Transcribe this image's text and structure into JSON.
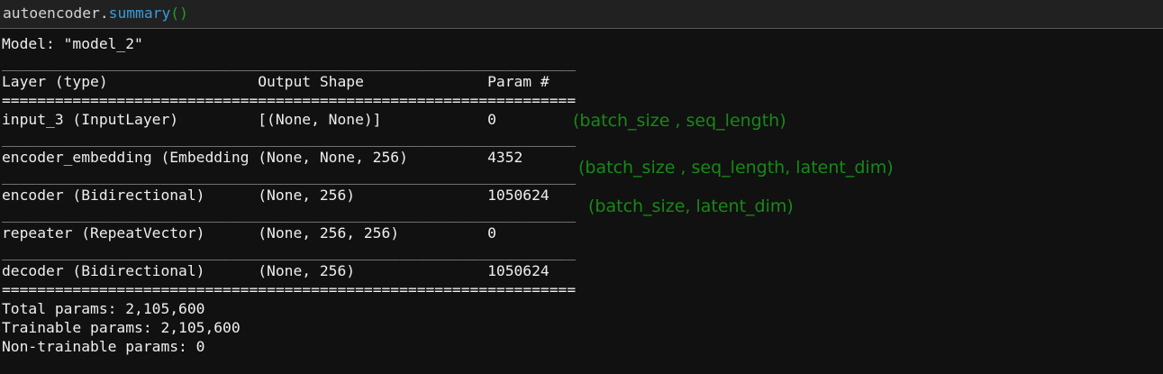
{
  "cell": {
    "object": "autoencoder",
    "dot": ".",
    "method": "summary",
    "parens": "()"
  },
  "output": {
    "model_line": "Model: \"model_2\"",
    "separator": "_________________________________________________________________",
    "double_separator": "=================================================================",
    "headers": {
      "layer": "Layer (type)",
      "shape": "Output Shape",
      "params": "Param #"
    },
    "rows": [
      {
        "layer": "input_3 (InputLayer)",
        "shape": "[(None, None)]",
        "params": "0"
      },
      {
        "layer": "encoder_embedding (Embedding",
        "shape": "(None, None, 256)",
        "params": "4352"
      },
      {
        "layer": "encoder (Bidirectional)",
        "shape": "(None, 256)",
        "params": "1050624"
      },
      {
        "layer": "repeater (RepeatVector)",
        "shape": "(None, 256, 256)",
        "params": "0"
      },
      {
        "layer": "decoder (Bidirectional)",
        "shape": "(None, 256)",
        "params": "1050624"
      }
    ],
    "total": "Total params: 2,105,600",
    "trainable": "Trainable params: 2,105,600",
    "non_trainable": "Non-trainable params: 0"
  },
  "annotations": [
    "(batch_size , seq_length)",
    "(batch_size , seq_length, latent_dim)",
    "(batch_size, latent_dim)"
  ],
  "colors": {
    "annotation": "#168a16",
    "method": "#3b9bdc",
    "parens": "#20a020"
  }
}
